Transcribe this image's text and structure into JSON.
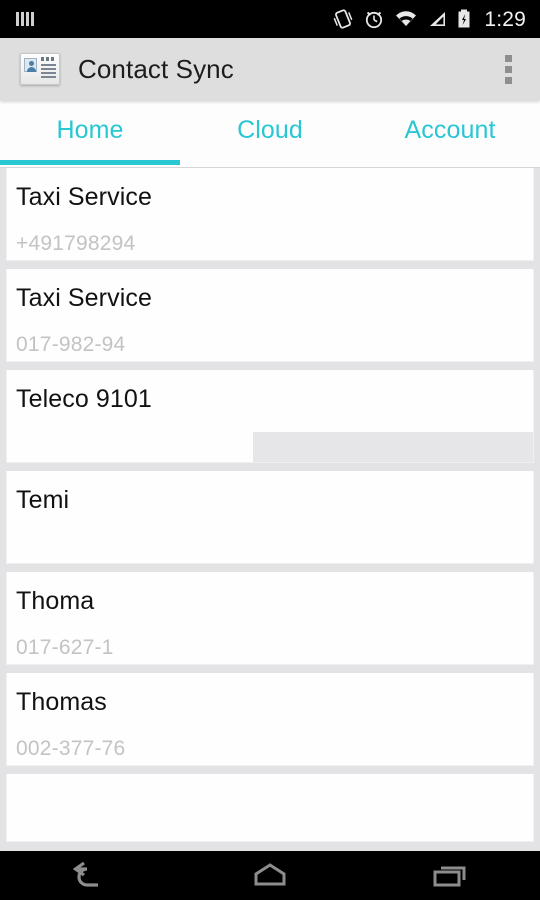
{
  "status_bar": {
    "signal_icon": "signal-bars-icon",
    "vibrate_icon": "vibrate-icon",
    "alarm_icon": "alarm-clock-icon",
    "wifi_icon": "wifi-icon",
    "cellular_icon": "cellular-signal-icon",
    "battery_icon": "battery-charging-icon",
    "time": "1:29"
  },
  "app_bar": {
    "icon": "contact-card-icon",
    "title": "Contact Sync",
    "overflow_icon": "overflow-menu-icon"
  },
  "tabs": [
    {
      "label": "Home",
      "active": true
    },
    {
      "label": "Cloud",
      "active": false
    },
    {
      "label": "Account",
      "active": false
    }
  ],
  "contacts": [
    {
      "name": "Taxi Service",
      "phone": "+491798294"
    },
    {
      "name": "Taxi Service",
      "phone": "017-982-94"
    },
    {
      "name": "Teleco 9101",
      "phone": ""
    },
    {
      "name": "Temi",
      "phone": ""
    },
    {
      "name": "Thoma",
      "phone": "017-627-1"
    },
    {
      "name": "Thomas",
      "phone": "002-377-76"
    },
    {
      "name": "",
      "phone": ""
    }
  ],
  "nav_bar": {
    "back_icon": "back-arrow-icon",
    "home_icon": "home-icon",
    "recents_icon": "recent-apps-icon"
  },
  "colors": {
    "accent": "#29c6d3",
    "app_bar_bg": "#dededf",
    "list_bg": "#e3e3e5",
    "card_bg": "#fefefe",
    "primary_text": "#121212",
    "secondary_text": "#c3c3c3"
  }
}
